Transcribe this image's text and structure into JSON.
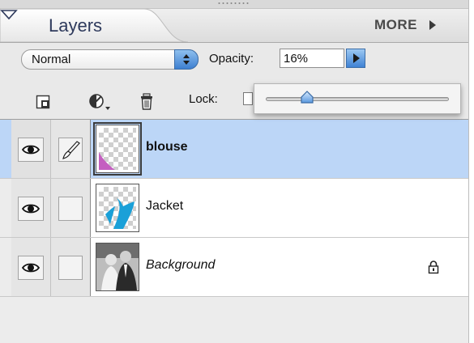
{
  "panel": {
    "title": "Layers",
    "more_label": "MORE"
  },
  "blend": {
    "mode": "Normal",
    "opacity_label": "Opacity:",
    "opacity_value": "16%",
    "opacity_fraction": 0.16
  },
  "lock": {
    "label": "Lock:"
  },
  "layers": [
    {
      "name": "blouse",
      "selected": true,
      "visible": true,
      "linked": true,
      "locked": false,
      "accent": "#c45fc0"
    },
    {
      "name": "Jacket",
      "selected": false,
      "visible": true,
      "linked": false,
      "locked": false,
      "accent": "#1aa0d8"
    },
    {
      "name": "Background",
      "selected": false,
      "visible": true,
      "linked": false,
      "locked": true
    }
  ],
  "colors": {
    "selection": "#bcd6f7",
    "accent_button": "#3f82d4"
  }
}
